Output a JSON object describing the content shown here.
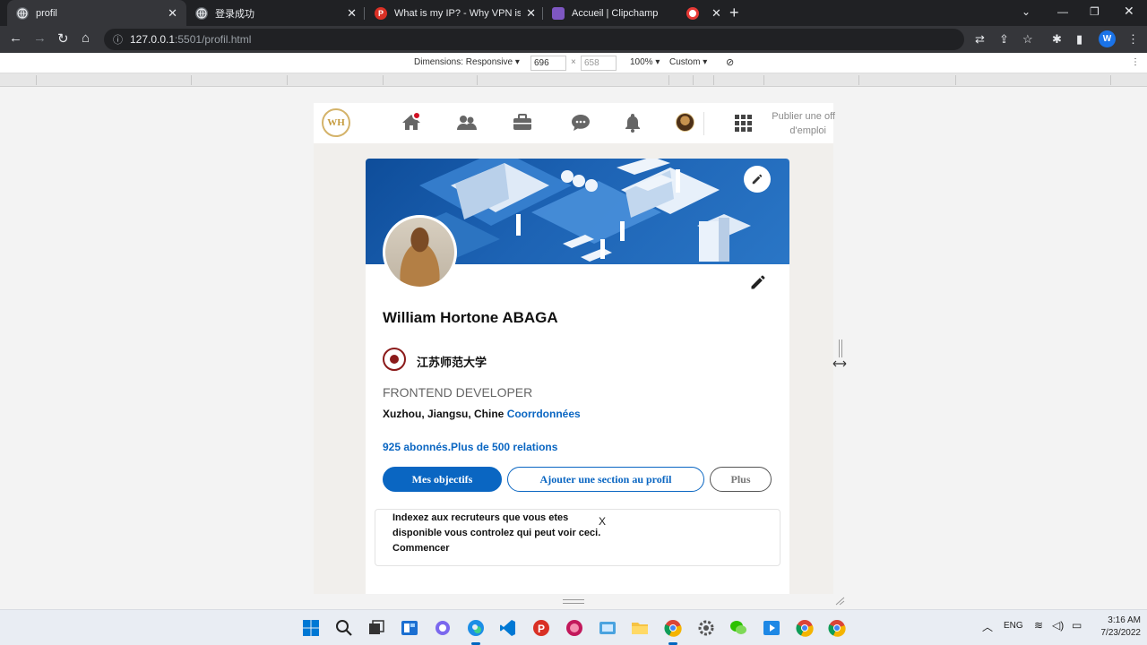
{
  "browser": {
    "tabs": [
      {
        "title": "profil",
        "active": true,
        "favicon_color": "#5f6368"
      },
      {
        "title": "登录成功",
        "active": false,
        "favicon_color": "#5f6368"
      },
      {
        "title": "What is my IP? - Why VPN is imp",
        "active": false,
        "favicon_color": "#d93025",
        "favicon_letter": "P"
      },
      {
        "title": "Accueil | Clipchamp",
        "active": false,
        "favicon_color": "#7e57c2"
      },
      {
        "title": "",
        "active": false,
        "favicon_color": "#e53935"
      }
    ],
    "url_host": "127.0.0.1",
    "url_path": ":5501/profil.html",
    "profile_letter": "W"
  },
  "devtools": {
    "dimensions_label": "Dimensions: Responsive",
    "width": "696",
    "height": "658",
    "zoom": "100%",
    "throttle": "Custom"
  },
  "site_nav": {
    "logo_text": "WH",
    "icons": [
      "home-icon",
      "network-icon",
      "jobs-icon",
      "messaging-icon",
      "notifications-icon",
      "me-avatar",
      "apps-grid-icon"
    ],
    "publish_line1": "Publier une off",
    "publish_line2": "d'emploi"
  },
  "profile": {
    "name": "William Hortone ABAGA",
    "school": "江苏师范大学",
    "headline": "FRONTEND DEVELOPER",
    "location": "Xuzhou, Jiangsu, Chine",
    "contact_link": "Coorrdonnées",
    "stats": "925 abonnés.Plus de 500 relations",
    "buttons": {
      "primary": "Mes objectifs",
      "add_section": "Ajouter une section au profil",
      "more": "Plus"
    },
    "notice": {
      "line1": "Indexez aux recruteurs que vous etes",
      "line2": "disponible vous controlez qui peut voir ceci.",
      "line3": "Commencer",
      "close": "X"
    }
  },
  "taskbar": {
    "language": "ENG",
    "time": "3:16 AM",
    "date": "7/23/2022"
  },
  "colors": {
    "accent": "#0a66c2",
    "banner": "#1d63b4",
    "notification": "#d11124"
  }
}
